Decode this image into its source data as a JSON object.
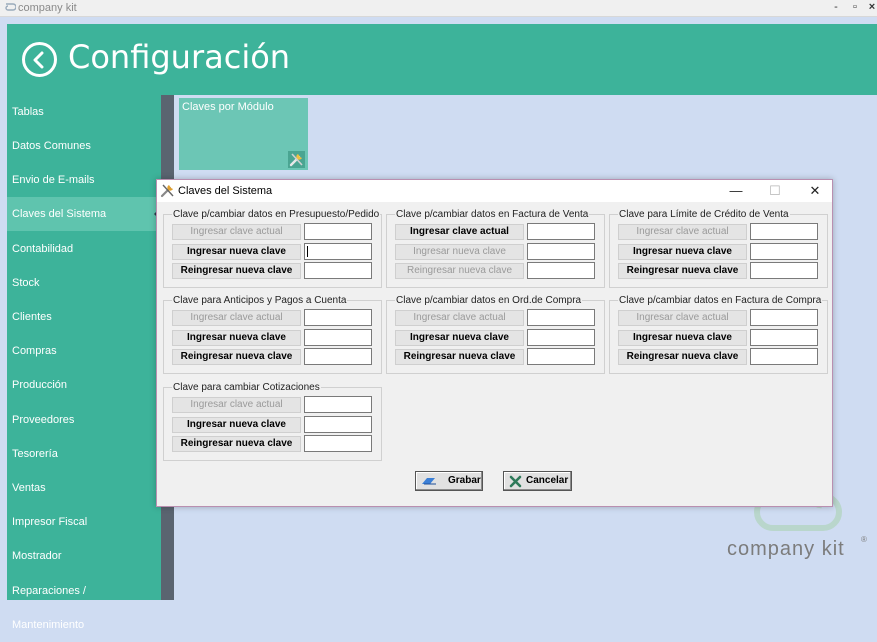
{
  "window": {
    "title": "company kit",
    "controls": [
      "-",
      "▫",
      "×"
    ]
  },
  "header": {
    "title": "Configuración"
  },
  "sidebar": {
    "items": [
      {
        "label": "Tablas"
      },
      {
        "label": "Datos Comunes"
      },
      {
        "label": "Envio de E-mails"
      },
      {
        "label": "Claves del Sistema",
        "active": true
      },
      {
        "label": "Contabilidad"
      },
      {
        "label": "Stock"
      },
      {
        "label": "Clientes"
      },
      {
        "label": "Compras"
      },
      {
        "label": "Producción"
      },
      {
        "label": "Proveedores"
      },
      {
        "label": "Tesorería"
      },
      {
        "label": "Ventas"
      },
      {
        "label": "Impresor Fiscal"
      },
      {
        "label": "Mostrador"
      },
      {
        "label": "Reparaciones / Mantenimiento"
      }
    ]
  },
  "tile": {
    "label": "Claves por Módulo",
    "icon": "tools-icon"
  },
  "watermark": {
    "text": "company kit",
    "mark": "®"
  },
  "dialog": {
    "title": "Claves del Sistema",
    "controls": {
      "minimize": "—",
      "maximize": "☐",
      "close": "✕"
    },
    "groups": [
      {
        "title": "Clave p/cambiar datos en Presupuesto/Pedido",
        "rows": [
          {
            "label": "Ingresar clave actual",
            "enabled": false,
            "value": ""
          },
          {
            "label": "Ingresar nueva clave",
            "enabled": true,
            "value": "",
            "focused": true
          },
          {
            "label": "Reingresar nueva clave",
            "enabled": true,
            "value": ""
          }
        ]
      },
      {
        "title": "Clave p/cambiar datos en Factura de Venta",
        "rows": [
          {
            "label": "Ingresar clave actual",
            "enabled": true,
            "value": ""
          },
          {
            "label": "Ingresar nueva clave",
            "enabled": false,
            "value": ""
          },
          {
            "label": "Reingresar nueva clave",
            "enabled": false,
            "value": ""
          }
        ]
      },
      {
        "title": "Clave para Límite de Crédito de Venta",
        "rows": [
          {
            "label": "Ingresar clave actual",
            "enabled": false,
            "value": ""
          },
          {
            "label": "Ingresar nueva clave",
            "enabled": true,
            "value": ""
          },
          {
            "label": "Reingresar nueva clave",
            "enabled": true,
            "value": ""
          }
        ]
      },
      {
        "title": "Clave para Anticipos y Pagos a Cuenta",
        "rows": [
          {
            "label": "Ingresar clave actual",
            "enabled": false,
            "value": ""
          },
          {
            "label": "Ingresar nueva clave",
            "enabled": true,
            "value": ""
          },
          {
            "label": "Reingresar nueva clave",
            "enabled": true,
            "value": ""
          }
        ]
      },
      {
        "title": "Clave p/cambiar datos en Ord.de Compra",
        "rows": [
          {
            "label": "Ingresar clave actual",
            "enabled": false,
            "value": ""
          },
          {
            "label": "Ingresar nueva clave",
            "enabled": true,
            "value": ""
          },
          {
            "label": "Reingresar nueva clave",
            "enabled": true,
            "value": ""
          }
        ]
      },
      {
        "title": "Clave p/cambiar datos en Factura de Compra",
        "rows": [
          {
            "label": "Ingresar clave actual",
            "enabled": false,
            "value": ""
          },
          {
            "label": "Ingresar nueva clave",
            "enabled": true,
            "value": ""
          },
          {
            "label": "Reingresar nueva clave",
            "enabled": true,
            "value": ""
          }
        ]
      },
      {
        "title": "Clave para cambiar Cotizaciones",
        "rows": [
          {
            "label": "Ingresar clave actual",
            "enabled": false,
            "value": ""
          },
          {
            "label": "Ingresar nueva clave",
            "enabled": true,
            "value": ""
          },
          {
            "label": "Reingresar nueva clave",
            "enabled": true,
            "value": ""
          }
        ]
      }
    ],
    "buttons": {
      "save": "Grabar",
      "cancel": "Cancelar"
    }
  },
  "colors": {
    "accent": "#3db39a",
    "sidebar_active": "#5fc4ae",
    "background": "#cfdcf2"
  }
}
